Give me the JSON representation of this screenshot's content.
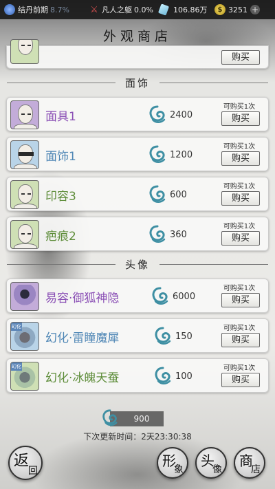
{
  "status_bar": {
    "realm": {
      "label": "结丹前期",
      "percent": "8.7%",
      "icon": "realm-orb-icon"
    },
    "power": {
      "label": "凡人之躯",
      "percent": "0.0%",
      "icon": "sword-icon"
    },
    "crystals": {
      "value": "106.86万",
      "icon": "spirit-crystal-icon"
    },
    "gold": {
      "value": "3251",
      "icon": "gold-coin-icon"
    }
  },
  "title": "外观商店",
  "partial_item": {
    "buy_label": "购买"
  },
  "sections": [
    {
      "title": "面饰",
      "items": [
        {
          "name": "面具1",
          "price": "2400",
          "limit": "可购买1次",
          "buy_label": "购买",
          "color": "#8a4fb5"
        },
        {
          "name": "面饰1",
          "price": "1200",
          "limit": "可购买1次",
          "buy_label": "购买",
          "color": "#4e86b5"
        },
        {
          "name": "印容3",
          "price": "600",
          "limit": "可购买1次",
          "buy_label": "购买",
          "color": "#5e8d3a"
        },
        {
          "name": "疤痕2",
          "price": "360",
          "limit": "可购买1次",
          "buy_label": "购买",
          "color": "#5e8d3a"
        }
      ]
    },
    {
      "title": "头像",
      "items": [
        {
          "name": "易容·御狐神隐",
          "price": "6000",
          "limit": "可购买1次",
          "buy_label": "购买",
          "color": "#8a4fb5"
        },
        {
          "name": "幻化·雷瞳魔犀",
          "price": "150",
          "limit": "可购买1次",
          "buy_label": "购买",
          "color": "#4e86b5",
          "tag": "幻化"
        },
        {
          "name": "幻化·冰魄天蚕",
          "price": "100",
          "limit": "可购买1次",
          "buy_label": "购买",
          "color": "#5e8d3a",
          "tag": "幻化"
        }
      ]
    }
  ],
  "footer": {
    "currency_amount": "900",
    "refresh_text": "下次更新时间：2天23:30:38"
  },
  "nav": {
    "back": [
      "返",
      "回"
    ],
    "appearance": [
      "形",
      "象"
    ],
    "portrait": [
      "头",
      "像"
    ],
    "shop": [
      "商",
      "店"
    ]
  }
}
